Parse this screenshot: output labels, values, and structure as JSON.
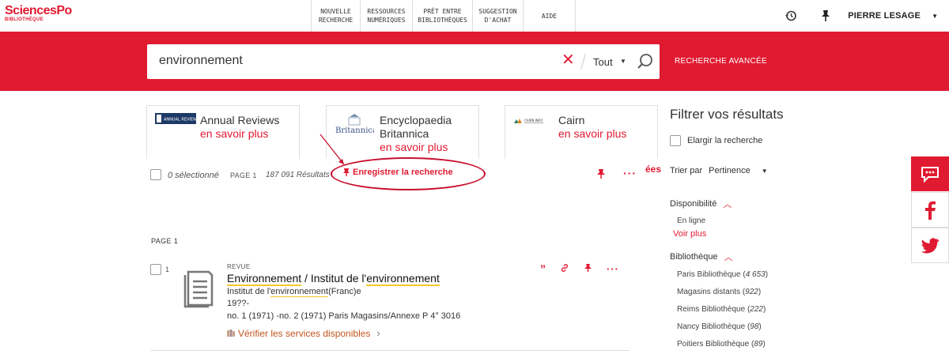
{
  "brand": {
    "name": "SciencesPo",
    "sub": "BIBLIOTHÈQUE",
    "color": "#e01a31"
  },
  "topnav": [
    {
      "label": "NOUVELLE\nRECHERCHE"
    },
    {
      "label": "RESSOURCES\nNUMÉRIQUES"
    },
    {
      "label": "PRÊT ENTRE\nBIBLIOTHÈQUES"
    },
    {
      "label": "SUGGESTION\nD'ACHAT"
    },
    {
      "label": "AIDE"
    }
  ],
  "user": {
    "name": "PIERRE LESAGE"
  },
  "search": {
    "value": "environnement",
    "scope": "Tout",
    "advanced": "RECHERCHE AVANCÉE"
  },
  "cards": [
    {
      "title": "Annual Reviews",
      "link": "en savoir plus",
      "logo_text": "ANNUAL REVIEWS"
    },
    {
      "title": "Encyclopaedia Britannica",
      "title1": "Encyclopaedia",
      "title2": "Britannica",
      "link": "en savoir plus",
      "logo_text": "Britannica"
    },
    {
      "title": "Cairn",
      "link": "en savoir plus",
      "logo_text": "CAIRN.INFO"
    }
  ],
  "results_bar": {
    "selected": "0 sélectionné",
    "page": "PAGE 1",
    "count": "187 091 Résultats",
    "save_search": "Enregistrer la recherche",
    "truncated": "ées"
  },
  "page_label": "PAGE 1",
  "results": [
    {
      "num": "1",
      "type": "REVUE",
      "title_hl1": "Environnement",
      "title_mid": " / Institut de l'",
      "title_hl2": "environnement",
      "author_pre": "Institut de l'",
      "author_hl": "environnement",
      "author_post": "(Franc)e",
      "date": "19??-",
      "holdings": "no. 1 (1971) -no. 2 (1971) Paris Magasins/Annexe P 4° 3016",
      "verify": "Vérifier les services disponibles"
    }
  ],
  "filters": {
    "title": "Filtrer vos résultats",
    "expand": "Elargir la recherche",
    "sort_label": "Trier par",
    "sort_value": "Pertinence",
    "availability": {
      "label": "Disponibilité",
      "items": [
        "En ligne"
      ],
      "more": "Voir plus"
    },
    "library": {
      "label": "Bibliothèque",
      "items": [
        {
          "name": "Paris Bibliothèque",
          "count": "4 653"
        },
        {
          "name": "Magasins distants",
          "count": "922"
        },
        {
          "name": "Reims Bibliothèque",
          "count": "222"
        },
        {
          "name": "Nancy Bibliothèque",
          "count": "98"
        },
        {
          "name": "Poitiers Bibliothèque",
          "count": "89"
        }
      ]
    }
  }
}
